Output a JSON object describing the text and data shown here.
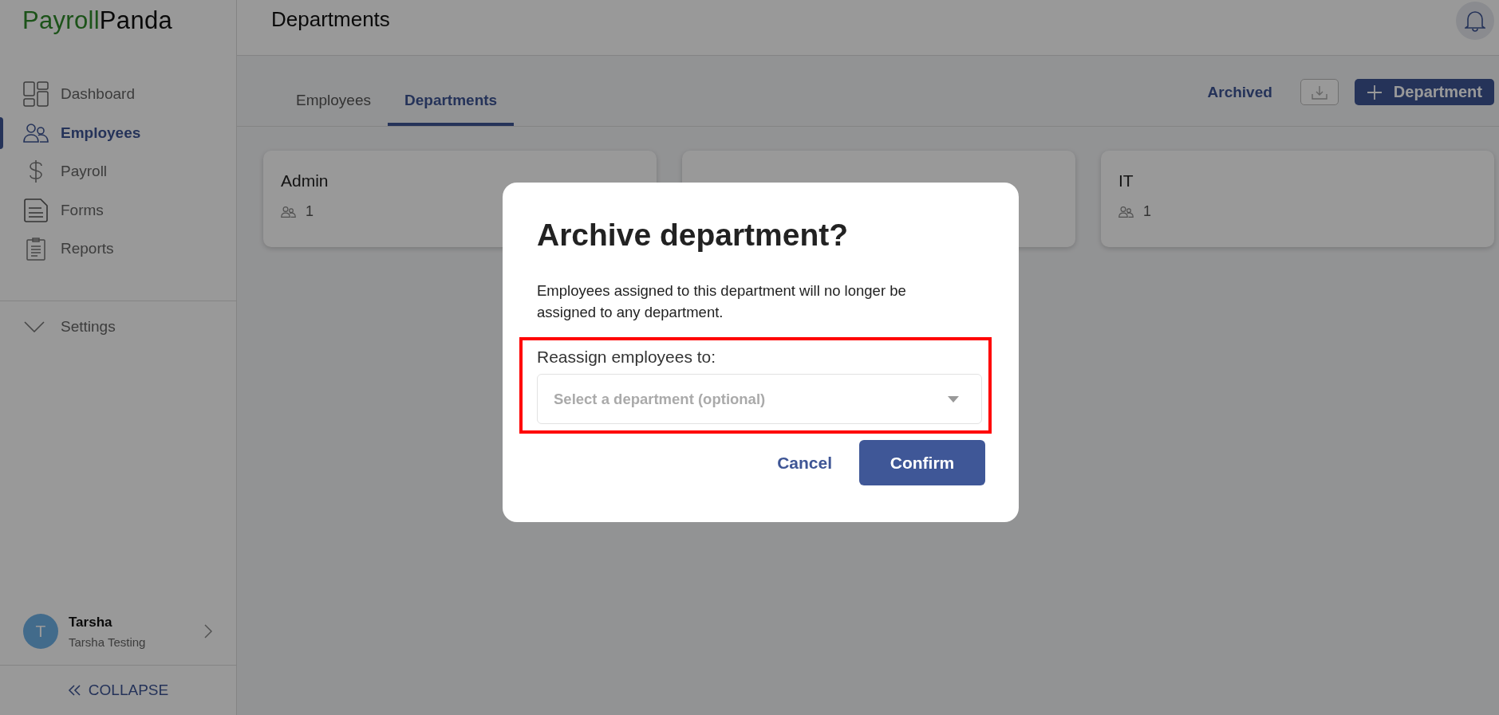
{
  "logo": {
    "first": "Payroll",
    "second": "Panda"
  },
  "sidebar": {
    "items": [
      {
        "label": "Dashboard",
        "selected": false
      },
      {
        "label": "Employees",
        "selected": true
      },
      {
        "label": "Payroll",
        "selected": false
      },
      {
        "label": "Forms",
        "selected": false
      },
      {
        "label": "Reports",
        "selected": false
      }
    ],
    "settings": {
      "label": "Settings",
      "expanded": false
    },
    "user": {
      "initial": "T",
      "name": "Tarsha",
      "subtitle": "Tarsha Testing"
    },
    "collapse": "COLLAPSE"
  },
  "header": {
    "title": "Departments"
  },
  "tabs": [
    {
      "label": "Employees",
      "selected": false
    },
    {
      "label": "Departments",
      "selected": true
    }
  ],
  "toolbar": {
    "archived_link": "Archived",
    "add_button": "Department"
  },
  "cards": [
    {
      "kind": "department",
      "name": "Admin",
      "count": "1"
    },
    {
      "kind": "covered"
    },
    {
      "kind": "department",
      "name": "IT",
      "count": "1"
    }
  ],
  "dialog": {
    "title": "Archive department?",
    "message": "Employees assigned to this department will no longer be assigned to any department.",
    "field_label": "Reassign employees to:",
    "placeholder": "Select a department (optional)",
    "highlighted": true,
    "buttons": [
      "Cancel",
      "Confirm"
    ]
  }
}
